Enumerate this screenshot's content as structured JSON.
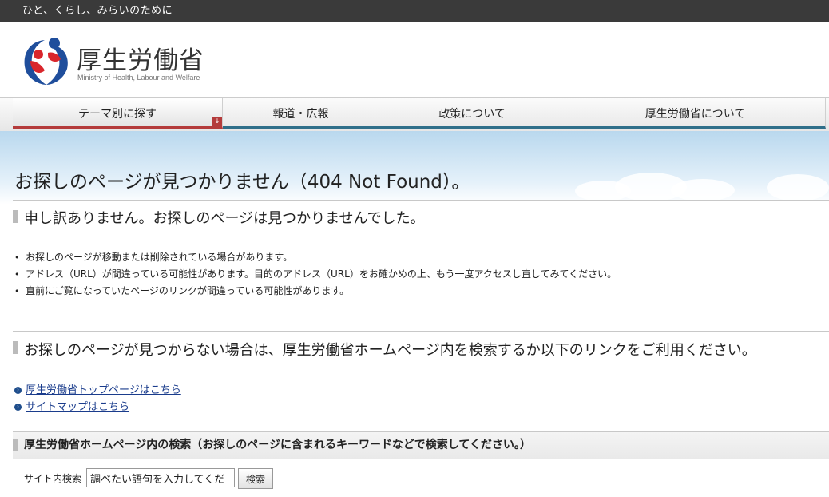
{
  "topbar": {
    "tagline": "ひと、くらし、みらいのために"
  },
  "header": {
    "site_name": "厚生労働省",
    "site_name_en": "Ministry of Health, Labour and Welfare"
  },
  "nav": {
    "items": [
      {
        "label": "テーマ別に探す"
      },
      {
        "label": "報道・広報"
      },
      {
        "label": "政策について"
      },
      {
        "label": "厚生労働省について"
      }
    ]
  },
  "main": {
    "title": "お探しのページが見つかりません（404 Not Found）。",
    "section1_heading": "申し訳ありません。お探しのページは見つかりませんでした。",
    "reasons": [
      "お探しのページが移動または削除されている場合があります。",
      "アドレス（URL）が間違っている可能性があります。目的のアドレス（URL）をお確かめの上、もう一度アクセスし直してみてください。",
      "直前にご覧になっていたページのリンクが間違っている可能性があります。"
    ],
    "section2_heading": "お探しのページが見つからない場合は、厚生労働省ホームページ内を検索するか以下のリンクをご利用ください。",
    "links": [
      {
        "label": "厚生労働省トップページはこちら"
      },
      {
        "label": "サイトマップはこちら"
      }
    ]
  },
  "search": {
    "heading": "厚生労働省ホームページ内の検索（お探しのページに含まれるキーワードなどで検索してください。）",
    "label": "サイト内検索",
    "input_value": "調べたい語句を入力してくだ",
    "button_label": "検索"
  },
  "colors": {
    "topbar_bg": "#3a3a3a",
    "nav_active_accent": "#b43b3b",
    "nav_accent": "#2f6f8a",
    "link": "#1a3c8c",
    "logo_blue": "#1f4e9c",
    "logo_red": "#d9262c"
  }
}
